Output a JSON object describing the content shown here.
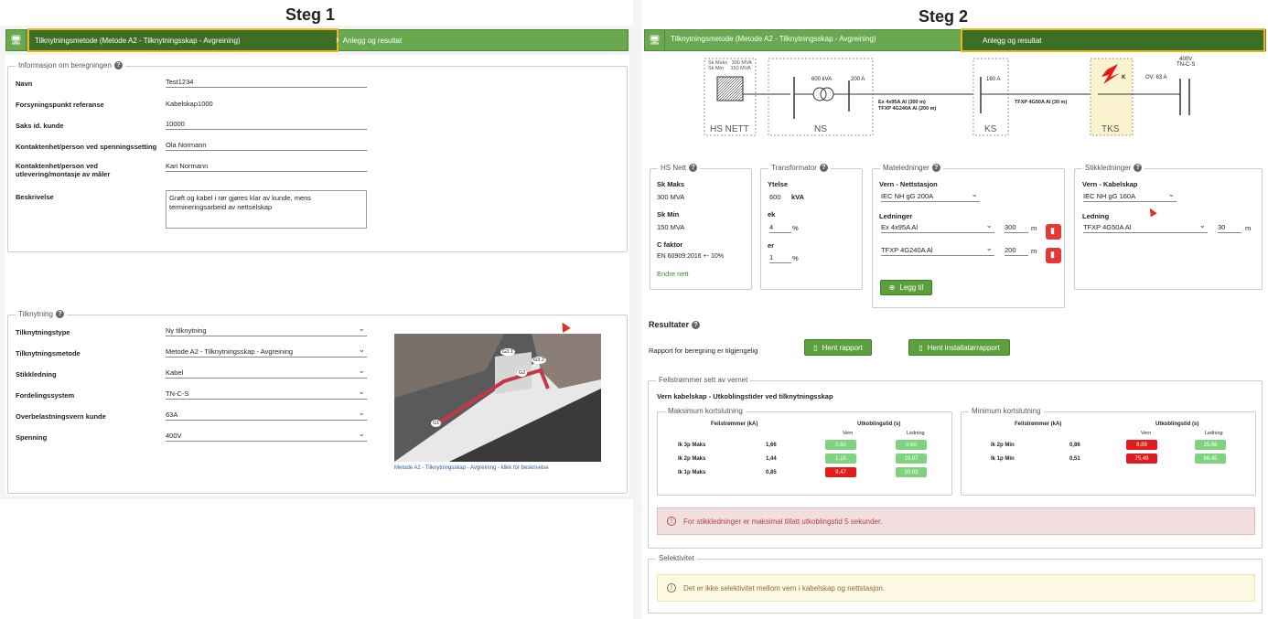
{
  "headings": {
    "step1": "Steg 1",
    "step2": "Steg 2"
  },
  "nav": {
    "step1_label": "Tilknytningsmetode (Metode A2 - Tilknytningsskap - Avgreining)",
    "step2_label": "Anlegg og resultat"
  },
  "info": {
    "legend": "Informasjon om beregningen",
    "fields": [
      {
        "label": "Navn",
        "value": "Test1234"
      },
      {
        "label": "Forsyningspunkt referanse",
        "value": "Kabelskap1000"
      },
      {
        "label": "Saks id. kunde",
        "value": "10000"
      },
      {
        "label": "Kontaktenhet/person ved spenningssetting",
        "value": "Ola Normann"
      },
      {
        "label": "Kontaktenhet/person ved utlevering/montasje av måler",
        "value": "Kari Normann"
      }
    ],
    "desc_label": "Beskrivelse",
    "desc_value": "Grøft og kabel i rør gjøres klar av kunde, mens termineringsarbeid av nettselskap"
  },
  "tilk": {
    "legend": "Tilknytning",
    "fields": [
      {
        "label": "Tilknytningstype",
        "value": "Ny tilknytning"
      },
      {
        "label": "Tilknytningsmetode",
        "value": "Metode A2 - Tilknytningsskap - Avgreining"
      },
      {
        "label": "Stikkledning",
        "value": "Kabel"
      },
      {
        "label": "Fordelingssystem",
        "value": "TN-C-S"
      },
      {
        "label": "Overbelastningsvern kunde",
        "value": "63A"
      },
      {
        "label": "Spenning",
        "value": "400V"
      }
    ],
    "image_caption": "Metode A2 - Tilknytningsskap - Avgreining - klikk for beskrivelse",
    "image_tags": [
      "G3.1",
      "G3.2",
      "G2",
      "G1"
    ]
  },
  "diagram": {
    "hs_label": "HS NETT",
    "hs_sk": "Sk Maks   300 MVA\nSk Min     150 MVA",
    "ns_label": "NS",
    "ns_kva": "600 kVA",
    "ns_a": "200 A",
    "line1": "Ex 4x95A Al (300 m)",
    "line2": "TFXP 4G240A Al (200 m)",
    "ks_label": "KS",
    "ks_a": "160 A",
    "line3": "TFXP 4G50A Al (30 m)",
    "tks_label": "TKS",
    "tks_k": "K",
    "ov": "OV. 63 A",
    "net": "400V\nTN-C-S"
  },
  "hs": {
    "legend": "HS Nett",
    "skmaks_l": "Sk Maks",
    "skmaks_v": "300 MVA",
    "skmin_l": "Sk Min",
    "skmin_v": "150 MVA",
    "cf_l": "C faktor",
    "cf_v": "EN 60909:2016 +- 10%",
    "link": "Endre nett"
  },
  "trafo": {
    "legend": "Transformator",
    "ytelse_l": "Ytelse",
    "ytelse_v": "600",
    "ytelse_u": "kVA",
    "ek_l": "ek",
    "ek_v": "4",
    "er_l": "er",
    "er_v": "1",
    "pct": "%"
  },
  "mate": {
    "legend": "Mateledninger",
    "vern_l": "Vern - Nettstasjon",
    "vern_v": "IEC NH gG 200A",
    "led_l": "Ledninger",
    "led1": "Ex 4x95A Al",
    "len1": "300",
    "led2": "TFXP 4G240A Al",
    "len2": "200",
    "unit": "m",
    "add": "Legg til"
  },
  "stikk": {
    "legend": "Stikkledninger",
    "vern_l": "Vern - Kabelskap",
    "vern_v": "IEC NH gG 160A",
    "led_l": "Ledning",
    "led_v": "TFXP 4G50A Al",
    "len": "30",
    "unit": "m"
  },
  "results": {
    "title": "Resultater",
    "text": "Rapport for beregning er tilgjengelig",
    "btn1": "Hent rapport",
    "btn2": "Hent installatørrapport"
  },
  "fault": {
    "legend": "Feilstrømmer sett av vernet",
    "title": "Vern kabelskap - Utkoblingstider ved tilknytningsskap",
    "max_legend": "Maksimum kortslutning",
    "min_legend": "Minimum kortslutning",
    "h_fs": "Feilstrømmer (kA)",
    "h_ut": "Utkoblingstid (s)",
    "h_vern": "Vern",
    "h_led": "Ledning",
    "max_rows": [
      {
        "name": "Ik 3p Maks",
        "ka": "1,66",
        "vern": "0,60",
        "led": "0,60"
      },
      {
        "name": "Ik 2p Maks",
        "ka": "1,44",
        "vern": "1,15",
        "led": "10,67"
      },
      {
        "name": "Ik 1p Maks",
        "ka": "0,85",
        "vern": "9,47",
        "led": "30,63"
      }
    ],
    "min_rows": [
      {
        "name": "Ik 2p Min",
        "ka": "0,86",
        "vern": "8,88",
        "led": "25,66"
      },
      {
        "name": "Ik 1p Min",
        "ka": "0,51",
        "vern": "75,49",
        "led": "88,45"
      }
    ],
    "alert": "For stikkledninger er maksimal tillatt utkoblingstid 5 sekunder."
  },
  "sel": {
    "legend": "Selektivitet",
    "alert": "Det er ikke selektivitet mellom vern i kabelskap og nettstasjon."
  },
  "colors": {
    "green": "#6aa84f",
    "dark_green": "#3c6e26",
    "highlight": "#f0b323",
    "red": "#e21c1c"
  }
}
